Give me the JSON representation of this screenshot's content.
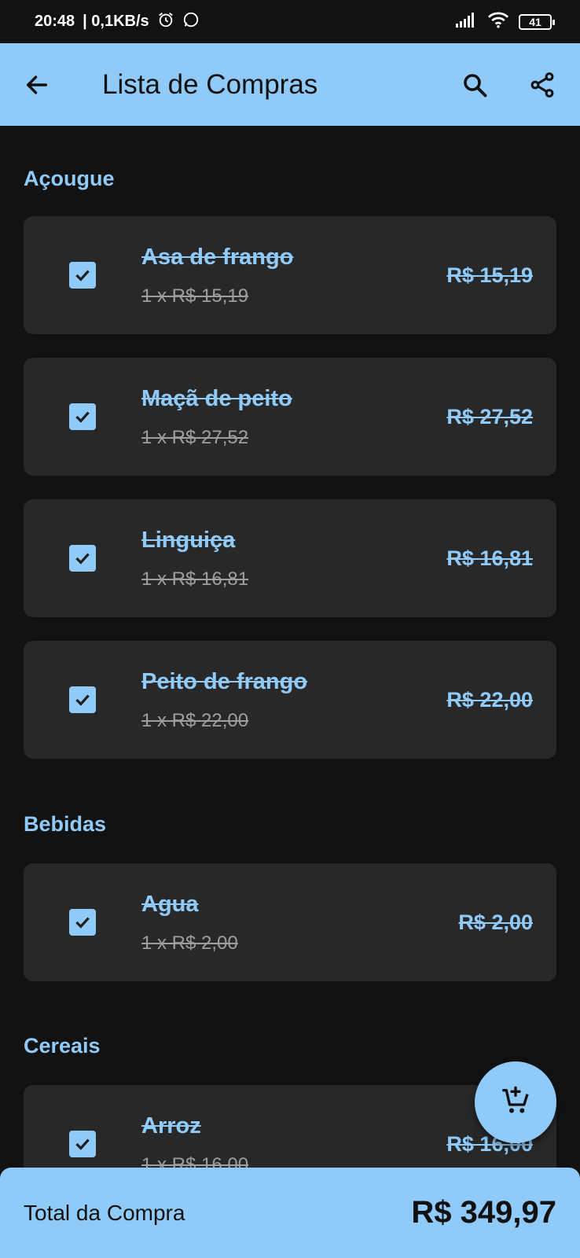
{
  "status_bar": {
    "time": "20:48",
    "net_speed": "| 0,1KB/s",
    "battery": "41"
  },
  "app_bar": {
    "title": "Lista de Compras",
    "back_icon": "arrow-left-icon",
    "search_icon": "search-icon",
    "share_icon": "share-icon"
  },
  "sections": [
    {
      "title": "Açougue",
      "items": [
        {
          "name": "Asa de frango",
          "qty": "1 x R$ 15,19",
          "price": "R$ 15,19",
          "checked": true
        },
        {
          "name": "Maçã de peito",
          "qty": "1 x R$ 27,52",
          "price": "R$ 27,52",
          "checked": true
        },
        {
          "name": "Linguiça",
          "qty": "1 x R$ 16,81",
          "price": "R$ 16,81",
          "checked": true
        },
        {
          "name": "Peito de frango",
          "qty": "1 x R$ 22,00",
          "price": "R$ 22,00",
          "checked": true
        }
      ]
    },
    {
      "title": "Bebidas",
      "items": [
        {
          "name": "Agua",
          "qty": "1 x R$ 2,00",
          "price": "R$ 2,00",
          "checked": true
        }
      ]
    },
    {
      "title": "Cereais",
      "items": [
        {
          "name": "Arroz",
          "qty": "1 x R$ 16,00",
          "price": "R$ 16,00",
          "checked": true
        }
      ]
    }
  ],
  "fab": {
    "icon": "add-to-cart-icon"
  },
  "footer": {
    "label": "Total da Compra",
    "total": "R$ 349,97"
  },
  "colors": {
    "accent": "#90caf9",
    "background": "#121212",
    "card": "#282828"
  }
}
